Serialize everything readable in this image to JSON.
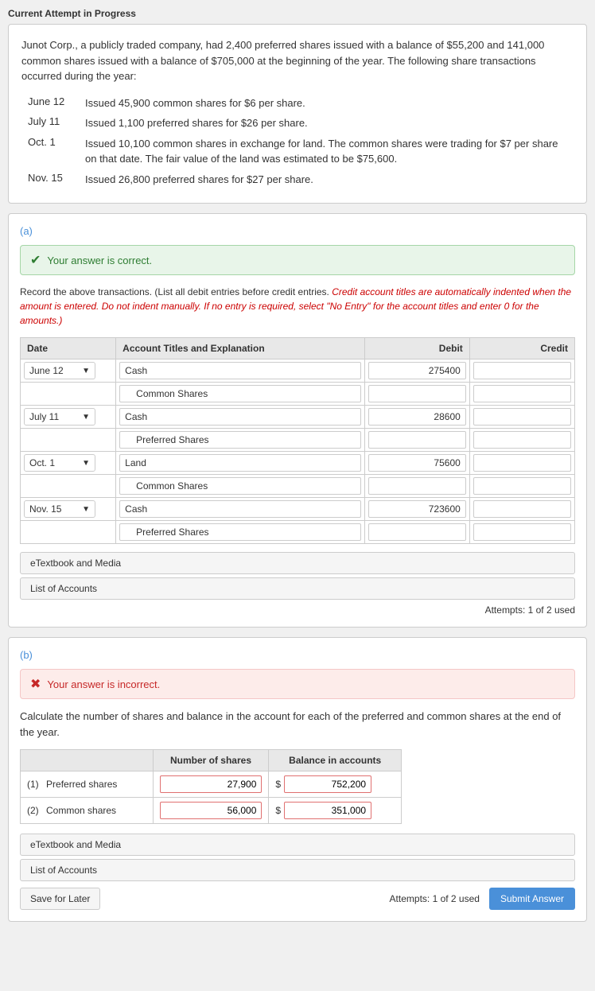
{
  "page": {
    "current_attempt_label": "Current Attempt in Progress"
  },
  "problem": {
    "intro": "Junot Corp., a publicly traded company, had 2,400 preferred shares issued with a balance of $55,200 and 141,000 common shares issued with a balance of $705,000 at the beginning of the year. The following share transactions occurred during the year:",
    "transactions": [
      {
        "date": "June 12",
        "description": "Issued 45,900 common shares for $6 per share."
      },
      {
        "date": "July 11",
        "description": "Issued 1,100 preferred shares for $26 per share."
      },
      {
        "date": "Oct. 1",
        "description": "Issued 10,100 common shares in exchange for land. The common shares were trading for $7 per share on that date. The fair value of the land was estimated to be $75,600."
      },
      {
        "date": "Nov. 15",
        "description": "Issued 26,800 preferred shares for $27 per share."
      }
    ]
  },
  "section_a": {
    "label": "(a)",
    "answer_status": "correct",
    "answer_text": "Your answer is correct.",
    "instructions": "Record the above transactions. (List all debit entries before credit entries.",
    "instructions_italic": "Credit account titles are automatically indented when the amount is entered. Do not indent manually. If no entry is required, select \"No Entry\" for the account titles and enter 0 for the amounts.)",
    "table_headers": {
      "date": "Date",
      "account": "Account Titles and Explanation",
      "debit": "Debit",
      "credit": "Credit"
    },
    "journal_entries": [
      {
        "date": "June 12",
        "rows": [
          {
            "account": "Cash",
            "debit": "275400",
            "credit": "",
            "indent": false
          },
          {
            "account": "Common Shares",
            "debit": "",
            "credit": "",
            "indent": true
          }
        ]
      },
      {
        "date": "July 11",
        "rows": [
          {
            "account": "Cash",
            "debit": "28600",
            "credit": "",
            "indent": false
          },
          {
            "account": "Preferred Shares",
            "debit": "",
            "credit": "",
            "indent": true
          }
        ]
      },
      {
        "date": "Oct. 1",
        "rows": [
          {
            "account": "Land",
            "debit": "75600",
            "credit": "",
            "indent": false
          },
          {
            "account": "Common Shares",
            "debit": "",
            "credit": "",
            "indent": true
          }
        ]
      },
      {
        "date": "Nov. 15",
        "rows": [
          {
            "account": "Cash",
            "debit": "723600",
            "credit": "",
            "indent": false
          },
          {
            "account": "Preferred Shares",
            "debit": "",
            "credit": "",
            "indent": true
          }
        ]
      }
    ],
    "buttons": {
      "etextbook": "eTextbook and Media",
      "list_accounts": "List of Accounts"
    },
    "attempts": "Attempts: 1 of 2 used"
  },
  "section_b": {
    "label": "(b)",
    "answer_status": "incorrect",
    "answer_text": "Your answer is incorrect.",
    "description": "Calculate the number of shares and balance in the account for each of the preferred and common shares at the end of the year.",
    "table_headers": {
      "col1": "",
      "col2": "Number of shares",
      "col3": "Balance in accounts"
    },
    "rows": [
      {
        "num": "(1)",
        "label": "Preferred shares",
        "num_shares": "27,900",
        "dollar": "$",
        "balance": "752,200"
      },
      {
        "num": "(2)",
        "label": "Common shares",
        "num_shares": "56,000",
        "dollar": "$",
        "balance": "351,000"
      }
    ],
    "buttons": {
      "etextbook": "eTextbook and Media",
      "list_accounts": "List of Accounts"
    },
    "attempts": "Attempts: 1 of 2 used",
    "save_label": "Save for Later",
    "submit_label": "Submit Answer"
  }
}
